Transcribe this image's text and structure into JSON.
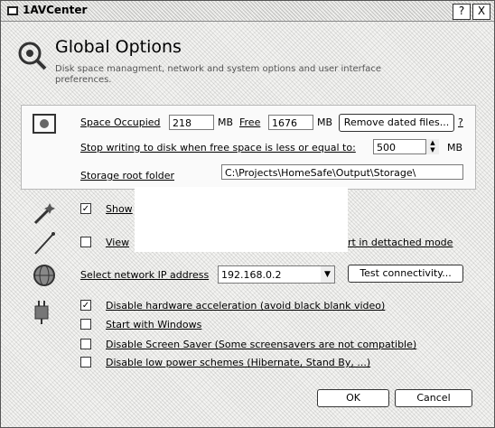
{
  "window": {
    "title": "1AVCenter",
    "minimize_label": "?",
    "close_label": "X"
  },
  "header": {
    "title": "Global Options",
    "description": "Disk space managment, network and system options and user interface preferences."
  },
  "disk": {
    "space_occupied_label": "Space Occupied",
    "space_occupied_value": "218",
    "space_occupied_unit": "MB",
    "free_label": "Free",
    "free_value": "1676",
    "free_unit": "MB",
    "remove_button": "Remove dated files...",
    "help_label": "?",
    "stop_label": "Stop writing to disk when free space is less or equal to:",
    "stop_value": "500",
    "stop_unit": "MB",
    "storage_label": "Storage root folder",
    "storage_value": "C:\\Projects\\HomeSafe\\Output\\Storage\\"
  },
  "ui": {
    "show_label": "Show",
    "view_label": "View",
    "detached_label": "rt in dettached mode"
  },
  "network": {
    "select_label": "Select network IP address",
    "ip_value": "192.168.0.2",
    "test_button": "Test connectivity..."
  },
  "system": {
    "options": [
      {
        "label": "Disable hardware acceleration (avoid black blank video)",
        "checked": "✓"
      },
      {
        "label": "Start with Windows",
        "checked": ""
      },
      {
        "label": "Disable Screen Saver  (Some screensavers are not compatible)",
        "checked": ""
      },
      {
        "label": "Disable low power schemes (Hibernate, Stand By, ...)",
        "checked": ""
      }
    ]
  },
  "footer": {
    "ok_label": "OK",
    "cancel_label": "Cancel"
  }
}
